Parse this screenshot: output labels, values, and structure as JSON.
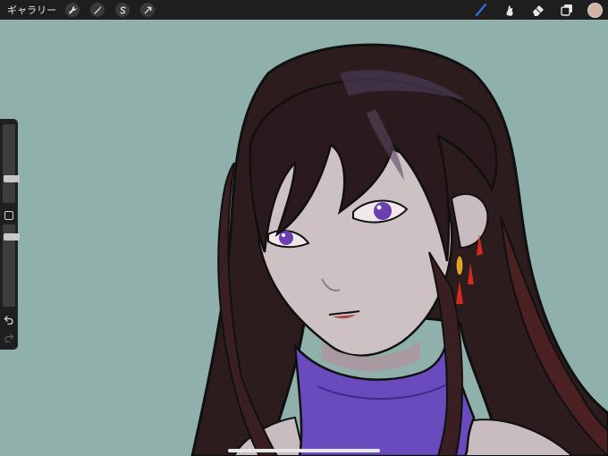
{
  "toolbar": {
    "gallery_label": "ギャラリー",
    "left_tools": [
      "wrench-icon",
      "magic-wand-icon",
      "selection-icon",
      "transform-icon"
    ],
    "right_tools": [
      "brush-icon",
      "smudge-icon",
      "eraser-icon",
      "layers-icon"
    ],
    "active_tool": "brush-icon",
    "accent_color": "#2f7cf6",
    "current_color": "#d4b4a2"
  },
  "sidebar": {
    "brush_size_level": 0.4,
    "opacity_level": 0.6
  },
  "canvas": {
    "background_color": "#8fb0ab"
  }
}
